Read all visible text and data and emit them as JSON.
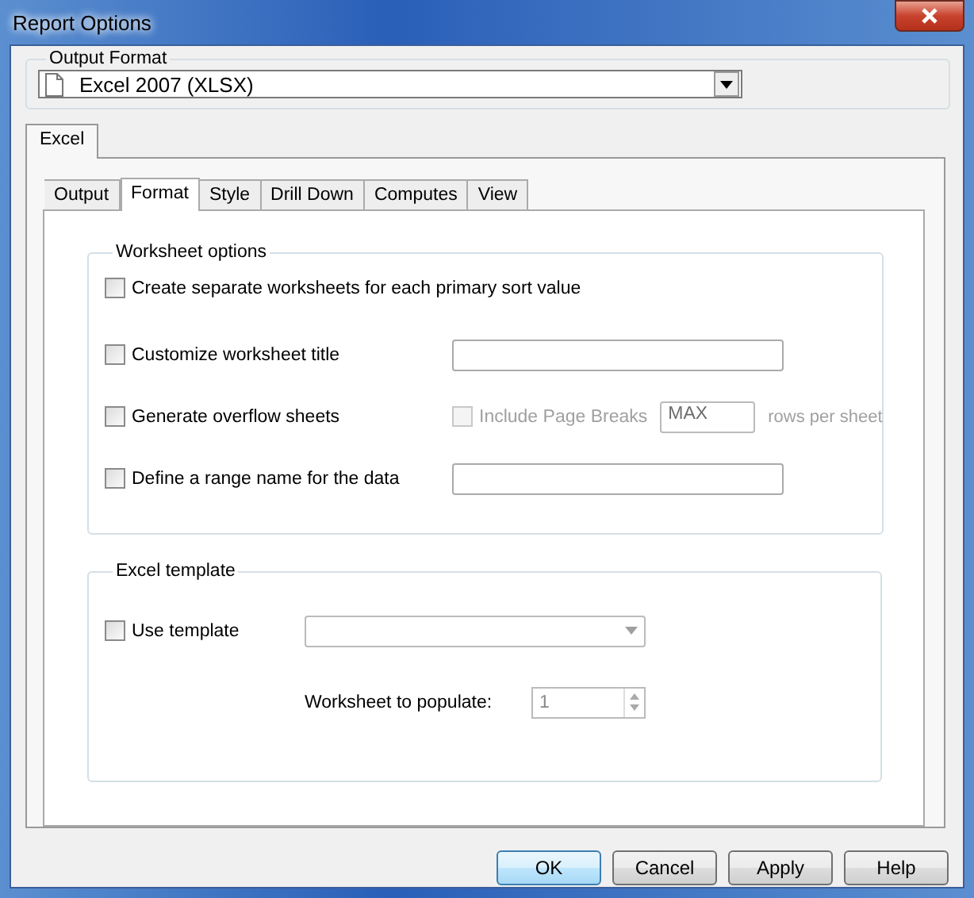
{
  "window": {
    "title": "Report Options"
  },
  "output_format": {
    "label": "Output Format",
    "value": "Excel 2007 (XLSX)"
  },
  "outer_tabs": [
    {
      "label": "Excel",
      "selected": true
    }
  ],
  "inner_tabs": [
    {
      "label": "Output",
      "selected": false
    },
    {
      "label": "Format",
      "selected": true
    },
    {
      "label": "Style",
      "selected": false
    },
    {
      "label": "Drill Down",
      "selected": false
    },
    {
      "label": "Computes",
      "selected": false
    },
    {
      "label": "View",
      "selected": false
    }
  ],
  "worksheet_options": {
    "title": "Worksheet options",
    "rows": [
      {
        "kind": "plain",
        "label": "Create separate worksheets for each primary sort value",
        "checked": false
      },
      {
        "kind": "field",
        "label": "Customize worksheet title",
        "checked": false
      },
      {
        "kind": "overflow",
        "label": "Generate overflow sheets",
        "checked": false,
        "sub_label": "Include Page Breaks",
        "sub_checked": false,
        "disabled": true,
        "value": "MAX",
        "suffix": "rows per sheet"
      },
      {
        "kind": "field",
        "label": "Define a range name for the data",
        "checked": false
      }
    ]
  },
  "excel_template": {
    "title": "Excel template",
    "use_template": {
      "label": "Use template",
      "checked": false
    },
    "populate": {
      "label": "Worksheet to populate:",
      "value": "1"
    }
  },
  "buttons": [
    {
      "label": "OK",
      "default": true
    },
    {
      "label": "Cancel",
      "default": false
    },
    {
      "label": "Apply",
      "default": false
    },
    {
      "label": "Help",
      "default": false
    }
  ]
}
